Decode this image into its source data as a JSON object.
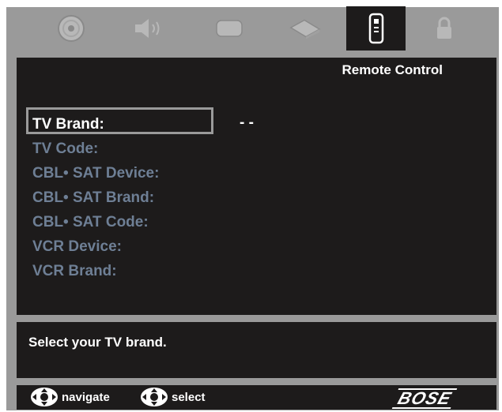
{
  "tabs": [
    {
      "icon": "disc-icon",
      "active": false
    },
    {
      "icon": "speaker-icon",
      "active": false
    },
    {
      "icon": "screen-icon",
      "active": false
    },
    {
      "icon": "wedge-icon",
      "active": false
    },
    {
      "icon": "remote-icon",
      "active": true
    },
    {
      "icon": "lock-icon",
      "active": false
    }
  ],
  "panel": {
    "title": "Remote Control"
  },
  "menu": {
    "items": [
      {
        "label": "TV Brand:"
      },
      {
        "label": "TV Code:"
      },
      {
        "label": "CBL• SAT Device:"
      },
      {
        "label": "CBL• SAT Brand:"
      },
      {
        "label": "CBL• SAT Code:"
      },
      {
        "label": "VCR Device:"
      },
      {
        "label": "VCR Brand:"
      }
    ],
    "selected_value": "- -"
  },
  "help": {
    "text": "Select your TV brand."
  },
  "footer": {
    "navigate_label": "navigate",
    "select_label": "select",
    "brand": "BOSE"
  },
  "colors": {
    "background": "#1d1b1b",
    "frame": "#9a9a9a",
    "inactive_label": "#6e7f95",
    "active_label": "#ffffff"
  }
}
